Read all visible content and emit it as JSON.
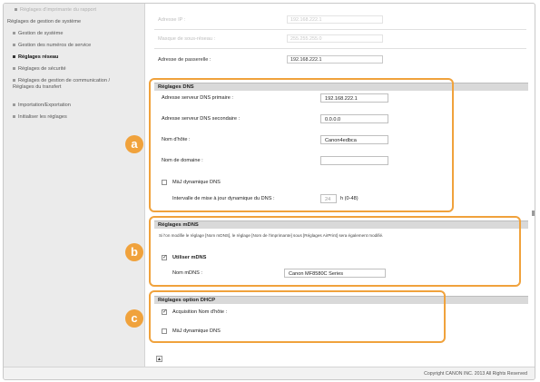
{
  "sidebar": {
    "items": [
      {
        "label": "Réglages d'imprimante du rapport",
        "style": "faded"
      },
      {
        "label": "Réglages de gestion de système",
        "style": "parent"
      },
      {
        "label": "Gestion de système"
      },
      {
        "label": "Gestion des numéros de service"
      },
      {
        "label": "Réglages réseau",
        "style": "active"
      },
      {
        "label": "Réglages de sécurité"
      },
      {
        "label": "Réglages de gestion de communication / Réglages du transfert"
      },
      {
        "label": "Importation/Exportation"
      },
      {
        "label": "Initialiser les réglages"
      }
    ]
  },
  "ip_rows": [
    {
      "label": "Adresse IP :",
      "value": "192.168.222.1",
      "faded": true
    },
    {
      "label": "Masque de sous-réseau :",
      "value": "255.255.255.0",
      "faded": true
    },
    {
      "label": "Adresse de passerelle :",
      "value": "192.168.222.1",
      "faded": false
    }
  ],
  "dns": {
    "header": "Réglages DNS",
    "primary_label": "Adresse serveur DNS primaire :",
    "primary_value": "192.168.222.1",
    "secondary_label": "Adresse serveur DNS secondaire :",
    "secondary_value": "0.0.0.0",
    "hostname_label": "Nom d'hôte :",
    "hostname_value": "Canon4edbca",
    "domain_label": "Nom de domaine :",
    "domain_value": "",
    "dyn_update_label": "MàJ dynamique DNS",
    "interval_label": "Intervalle de mise à jour dynamique du DNS :",
    "interval_value": "24",
    "interval_unit": "h (0-48)"
  },
  "mdns": {
    "header": "Réglages mDNS",
    "note": "Si l'on modifie le réglage [Nom mDNS], le réglage [Nom de l'imprimante] sous [Réglages AirPrint] sera également modifié.",
    "use_label": "Utiliser mDNS",
    "name_label": "Nom mDNS :",
    "name_value": "Canon MF8580C Series"
  },
  "dhcp": {
    "header": "Réglages option DHCP",
    "acquire_label": "Acquisition Nom d'hôte :",
    "dyn_update_label": "MàJ dynamique DNS"
  },
  "callouts": {
    "a": "a",
    "b": "b",
    "c": "c"
  },
  "footer": {
    "copyright": "Copyright CANON INC. 2013 All Rights Reserved"
  },
  "icons": {
    "top_button": "up-arrow-icon",
    "checkbox_checked": "✓"
  }
}
